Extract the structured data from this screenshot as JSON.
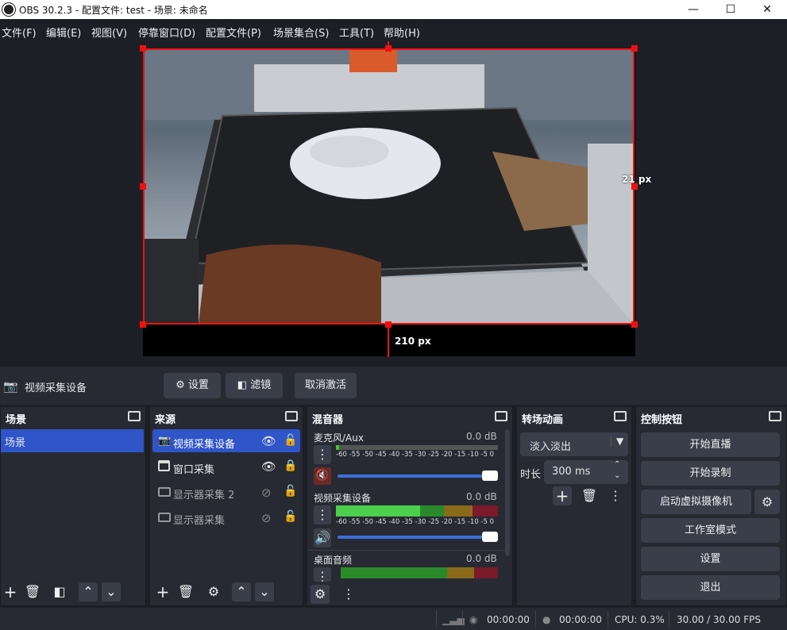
{
  "window": {
    "title": "OBS 30.2.3 - 配置文件: test - 场景: 未命名",
    "minimize": "—",
    "maximize": "☐",
    "close": "✕"
  },
  "menu": [
    "文件(F)",
    "编辑(E)",
    "视图(V)",
    "停靠窗口(D)",
    "配置文件(P)",
    "场景集合(S)",
    "工具(T)",
    "帮助(H)"
  ],
  "preview": {
    "offset_right": "21 px",
    "offset_bottom": "210 px"
  },
  "source_toolbar": {
    "source_name": "视频采集设备",
    "settings": "设置",
    "filters": "滤镜",
    "deactivate": "取消激活"
  },
  "scenes": {
    "title": "场景",
    "items": [
      "场景"
    ]
  },
  "sources": {
    "title": "来源",
    "items": [
      {
        "name": "视频采集设备",
        "visible": true,
        "locked": false,
        "selected": true
      },
      {
        "name": "窗口采集",
        "visible": true,
        "locked": true,
        "selected": false
      },
      {
        "name": "显示器采集 2",
        "visible": false,
        "locked": false,
        "selected": false
      },
      {
        "name": "显示器采集",
        "visible": false,
        "locked": false,
        "selected": false
      }
    ]
  },
  "mixer": {
    "title": "混音器",
    "scale": "-60 -55 -50 -45 -40 -35 -30 -25 -20 -15 -10 -5 0",
    "channels": [
      {
        "name": "麦克风/Aux",
        "db": "0.0 dB",
        "muted": true,
        "level": 0.0
      },
      {
        "name": "视频采集设备",
        "db": "0.0 dB",
        "muted": false,
        "level": 0.52
      },
      {
        "name": "桌面音频",
        "db": "0.0 dB",
        "muted": false,
        "level": 0.0
      }
    ]
  },
  "transitions": {
    "title": "转场动画",
    "type": "淡入淡出",
    "duration_label": "时长",
    "duration": "300 ms"
  },
  "controls": {
    "title": "控制按钮",
    "start_stream": "开始直播",
    "start_record": "开始录制",
    "virtual_cam": "启动虚拟摄像机",
    "studio_mode": "工作室模式",
    "settings": "设置",
    "exit": "退出"
  },
  "status": {
    "stream_time": "00:00:00",
    "record_time": "00:00:00",
    "cpu": "CPU: 0.3%",
    "fps": "30.00 / 30.00 FPS"
  },
  "colors": {
    "accent": "#2f55c8",
    "bg": "#1d1f26",
    "panel": "#272a33",
    "button": "#3a3e4a",
    "selection": "#e11111"
  }
}
